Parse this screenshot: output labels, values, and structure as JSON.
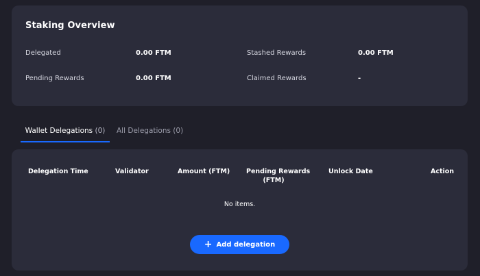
{
  "overview": {
    "title": "Staking Overview",
    "delegated_label": "Delegated",
    "delegated_value": "0.00 FTM",
    "stashed_label": "Stashed Rewards",
    "stashed_value": "0.00 FTM",
    "pending_label": "Pending Rewards",
    "pending_value": "0.00 FTM",
    "claimed_label": "Claimed Rewards",
    "claimed_value": "-"
  },
  "tabs": {
    "wallet_label": "Wallet Delegations",
    "wallet_count": "(0)",
    "all_label": "All Delegations (0)"
  },
  "table": {
    "columns": {
      "delegation_time": "Delegation Time",
      "validator": "Validator",
      "amount": "Amount (FTM)",
      "pending_rewards_line1": "Pending Rewards",
      "pending_rewards_line2": "(FTM)",
      "unlock_date": "Unlock Date",
      "action": "Action"
    },
    "empty_message": "No items.",
    "add_button_label": "Add delegation",
    "add_button_icon": "plus-icon"
  },
  "colors": {
    "background": "#1f1f29",
    "card": "#2b2c3a",
    "accent": "#1969ff"
  }
}
